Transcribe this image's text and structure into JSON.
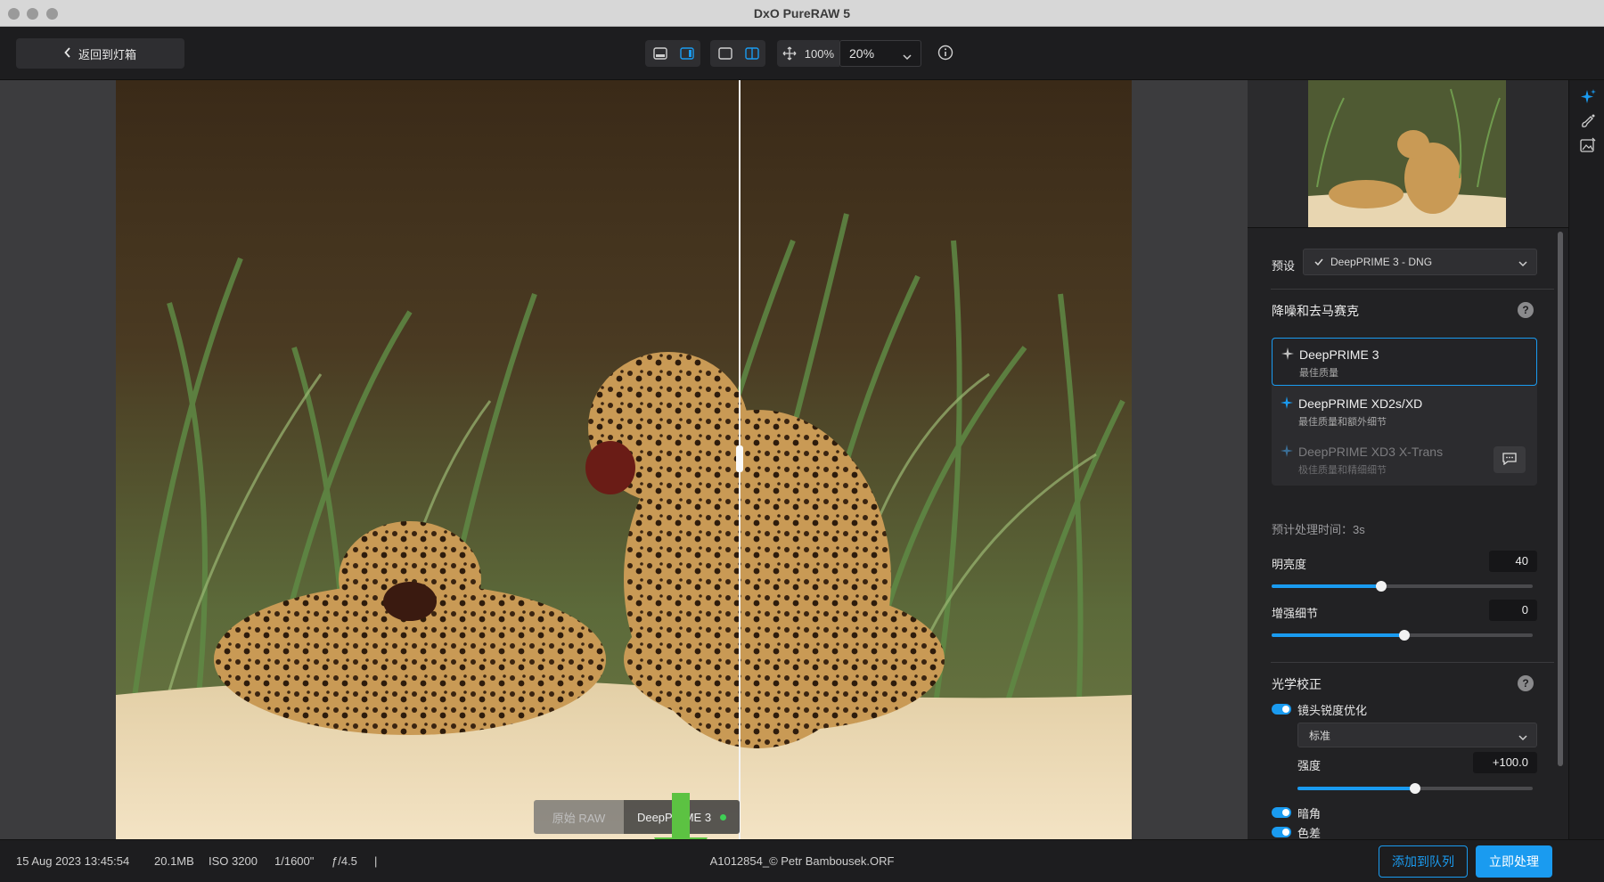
{
  "window": {
    "title": "DxO PureRAW 5"
  },
  "toolbar": {
    "back_label": "返回到灯箱",
    "zoom_fit": "100%",
    "zoom_value": "20%"
  },
  "compare": {
    "left_label": "原始 RAW",
    "right_label": "DeepPRIME 3"
  },
  "panel": {
    "preset_label": "预设",
    "preset_value": "DeepPRIME 3 - DNG",
    "denoise_title": "降噪和去马赛克",
    "help": "?",
    "denoise_options": [
      {
        "title": "DeepPRIME 3",
        "subtitle": "最佳质量",
        "selected": true,
        "disabled": false
      },
      {
        "title": "DeepPRIME XD2s/XD",
        "subtitle": "最佳质量和额外细节",
        "selected": false,
        "disabled": false
      },
      {
        "title": "DeepPRIME XD3 X-Trans",
        "subtitle": "极佳质量和精细细节",
        "selected": false,
        "disabled": true
      }
    ],
    "eta": "预计处理时间：3s",
    "brightness": {
      "label": "明亮度",
      "value": "40",
      "fill": 0.42
    },
    "detail": {
      "label": "增强细节",
      "value": "0",
      "fill": 0.51
    },
    "optics_title": "光学校正",
    "lens_sharpness": {
      "label": "镜头锐度优化",
      "on": true
    },
    "lens_mode": "标准",
    "intensity": {
      "label": "强度",
      "value": "+100.0",
      "fill": 0.5
    },
    "vignette": {
      "label": "暗角",
      "on": true
    },
    "chroma": {
      "label": "色差",
      "on": true
    }
  },
  "status": {
    "date": "15 Aug 2023 13:45:54",
    "size": "20.1MB",
    "iso": "ISO 3200",
    "shutter": "1/1600\"",
    "aperture": "ƒ/4.5",
    "sep": "|",
    "filename": "A1012854_© Petr Bambousek.ORF",
    "add_queue": "添加到队列",
    "process_now": "立即处理"
  },
  "colors": {
    "accent": "#1a9bf0",
    "dot": "#3fcf55",
    "arrow": "#5cc242"
  }
}
